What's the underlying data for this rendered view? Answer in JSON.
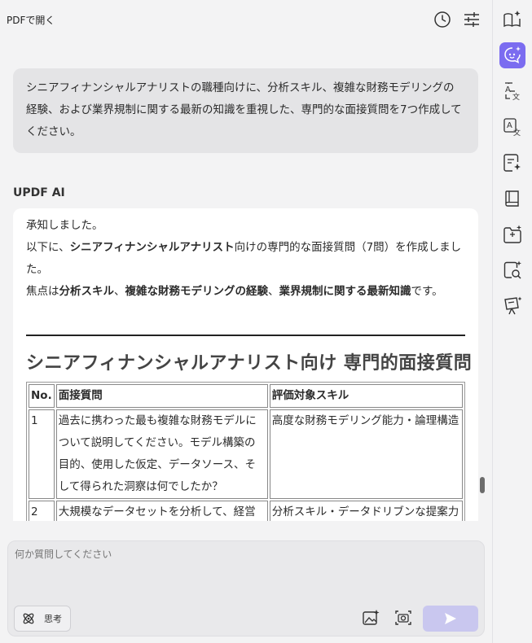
{
  "topbar": {
    "title": "PDFで開く",
    "icons": [
      "history-icon",
      "settings-sliders-icon"
    ]
  },
  "user_message": {
    "text": "シニアフィナンシャルアナリストの職種向けに、分析スキル、複雑な財務モデリングの経験、および業界規制に関する最新の知識を重視した、専門的な面接質問を7つ作成してください。"
  },
  "ai": {
    "label": "UPDF AI",
    "line1": "承知しました。",
    "line2_pre": "以下に、",
    "line2_bold": "シニアフィナンシャルアナリスト",
    "line2_post": "向けの専門的な面接質問（7問）を作成しました。",
    "line3_pre": "焦点は",
    "line3_b1": "分析スキル",
    "line3_sep1": "、",
    "line3_b2": "複雑な財務モデリングの経験",
    "line3_sep2": "、",
    "line3_b3": "業界規制に関する最新知識",
    "line3_post": "です。",
    "heading": "シニアフィナンシャルアナリスト向け 専門的面接質問",
    "table": {
      "headers": [
        "No.",
        "面接質問",
        "評価対象スキル"
      ],
      "rows": [
        {
          "no": "1",
          "question": "過去に携わった最も複雑な財務モデルについて説明してください。モデル構築の目的、使用した仮定、データソース、そして得られた洞察は何でしたか？",
          "skill": "高度な財務モデリング能力・論理構造"
        },
        {
          "no": "2",
          "question": "大規模なデータセットを分析して、経営",
          "skill": "分析スキル・データドリブンな提案力"
        }
      ]
    }
  },
  "input": {
    "placeholder": "何か質問してください",
    "think_label": "思考"
  },
  "sidebar": {
    "icons": [
      "reader-sparkle-icon",
      "ai-chat-icon",
      "translate-icon",
      "translate-page-icon",
      "summarize-icon",
      "book-icon",
      "folder-sparkle-icon",
      "search-doc-icon",
      "presentation-icon"
    ],
    "active_color": "#7b6cf0"
  },
  "colors": {
    "send_button": "#c9c7ef",
    "user_bubble": "#e4e4e6"
  }
}
